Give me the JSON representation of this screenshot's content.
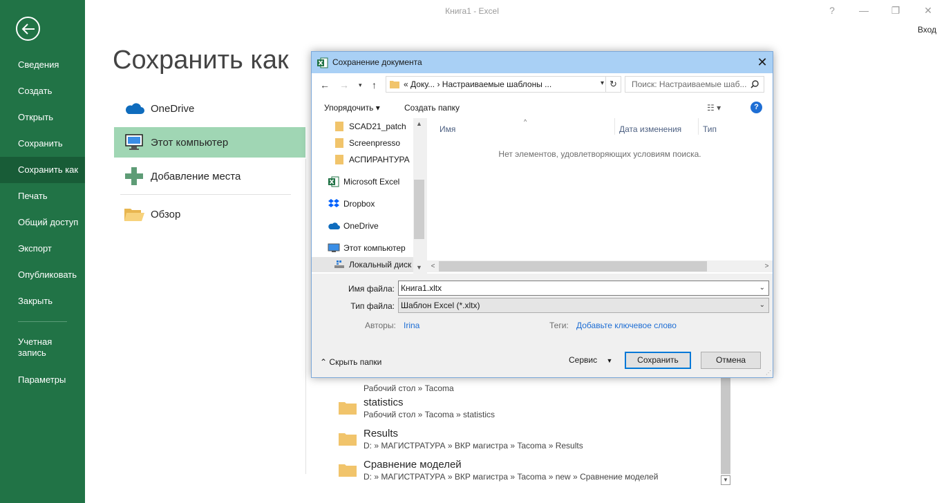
{
  "window": {
    "title": "Книга1 - Excel",
    "help_glyph": "?",
    "minimize_glyph": "—",
    "restore_glyph": "❐",
    "close_glyph": "✕",
    "sign_in": "Вход"
  },
  "rail": {
    "items": [
      "Сведения",
      "Создать",
      "Открыть",
      "Сохранить",
      "Сохранить как",
      "Печать",
      "Общий доступ",
      "Экспорт",
      "Опубликовать",
      "Закрыть"
    ],
    "active_item": "Сохранить как",
    "account_line1": "Учетная",
    "account_line2": "запись",
    "options": "Параметры"
  },
  "backstage": {
    "title": "Сохранить как",
    "locations": [
      {
        "label": "OneDrive",
        "icon": "cloud-icon"
      },
      {
        "label": "Этот компьютер",
        "icon": "computer-icon"
      },
      {
        "label": "Добавление места",
        "icon": "plus-icon"
      },
      {
        "label": "Обзор",
        "icon": "open-folder-icon"
      }
    ],
    "selected_location": "Этот компьютер",
    "recent_folders": [
      {
        "name": "",
        "path": "Рабочий стол » Tacoma"
      },
      {
        "name": "statistics",
        "path": "Рабочий стол » Tacoma » statistics"
      },
      {
        "name": "Results",
        "path": "D: » МАГИСТРАТУРА » ВКР магистра » Tacoma » Results"
      },
      {
        "name": "Сравнение моделей",
        "path": "D: » МАГИСТРАТУРА » ВКР магистра » Tacoma » new » Сравнение моделей"
      }
    ]
  },
  "dialog": {
    "title": "Сохранение документа",
    "address_crumbs": "«  Доку...  ›   Настраиваемые шаблоны ...",
    "search_placeholder": "Поиск: Настраиваемые шаб...",
    "organize": "Упорядочить ▾",
    "new_folder": "Создать папку",
    "view_glyph": "☷ ▾",
    "help_glyph": "?",
    "tree": [
      {
        "label": "SCAD21_patch",
        "icon": "folder-icon"
      },
      {
        "label": "Screenpresso",
        "icon": "folder-icon"
      },
      {
        "label": "АСПИРАНТУРА",
        "icon": "folder-icon"
      },
      {
        "label": "Microsoft Excel",
        "icon": "excel-icon"
      },
      {
        "label": "Dropbox",
        "icon": "dropbox-icon"
      },
      {
        "label": "OneDrive",
        "icon": "cloud-icon"
      },
      {
        "label": "Этот компьютер",
        "icon": "computer-icon"
      },
      {
        "label": "Локальный диск",
        "icon": "drive-icon"
      }
    ],
    "columns": {
      "name": "Имя",
      "date": "Дата изменения",
      "type": "Тип"
    },
    "empty_message": "Нет элементов, удовлетворяющих условиям поиска.",
    "file_name_label": "Имя файла:",
    "file_name_value": "Книга1.xltx",
    "file_type_label": "Тип файла:",
    "file_type_value": "Шаблон Excel (*.xltx)",
    "authors_label": "Авторы:",
    "authors_value": "Irina",
    "tags_label": "Теги:",
    "tags_value": "Добавьте ключевое слово",
    "hide_folders": "Скрыть папки",
    "service": "Сервис",
    "save": "Сохранить",
    "cancel": "Отмена"
  }
}
